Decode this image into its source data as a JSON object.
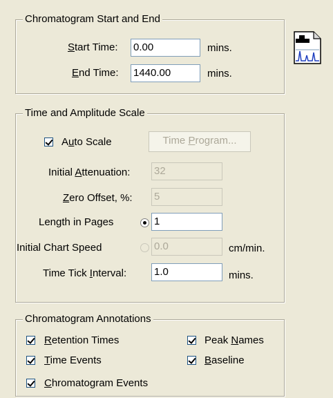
{
  "start_end": {
    "legend": "Chromatogram Start and End",
    "start_label": "Start Time:",
    "start_value": "0.00",
    "end_label": "End Time:",
    "end_value": "1440.00",
    "unit": "mins."
  },
  "scale": {
    "legend": "Time and Amplitude Scale",
    "auto_scale_label": "Auto Scale",
    "auto_scale_checked": true,
    "time_program_button": "Time Program...",
    "initial_attenuation_label": "Initial Attenuation:",
    "initial_attenuation_value": "32",
    "zero_offset_label": "Zero Offset, %:",
    "zero_offset_value": "5",
    "length_label": "Length in Pages",
    "length_value": "1",
    "chart_speed_label": "Initial Chart Speed",
    "chart_speed_value": "0.0",
    "chart_speed_unit": "cm/min.",
    "tick_label": "Time Tick Interval:",
    "tick_value": "1.0",
    "tick_unit": "mins."
  },
  "annotations": {
    "legend": "Chromatogram Annotations",
    "retention_times": "Retention Times",
    "time_events": "Time Events",
    "chromatogram_events": "Chromatogram Events",
    "peak_names": "Peak Names",
    "baseline": "Baseline"
  },
  "icons": {
    "chromatogram": "chromatogram-page-icon"
  },
  "colors": {
    "background": "#ece9d8",
    "field_border": "#7f9db9",
    "disabled_text": "#aca899"
  }
}
